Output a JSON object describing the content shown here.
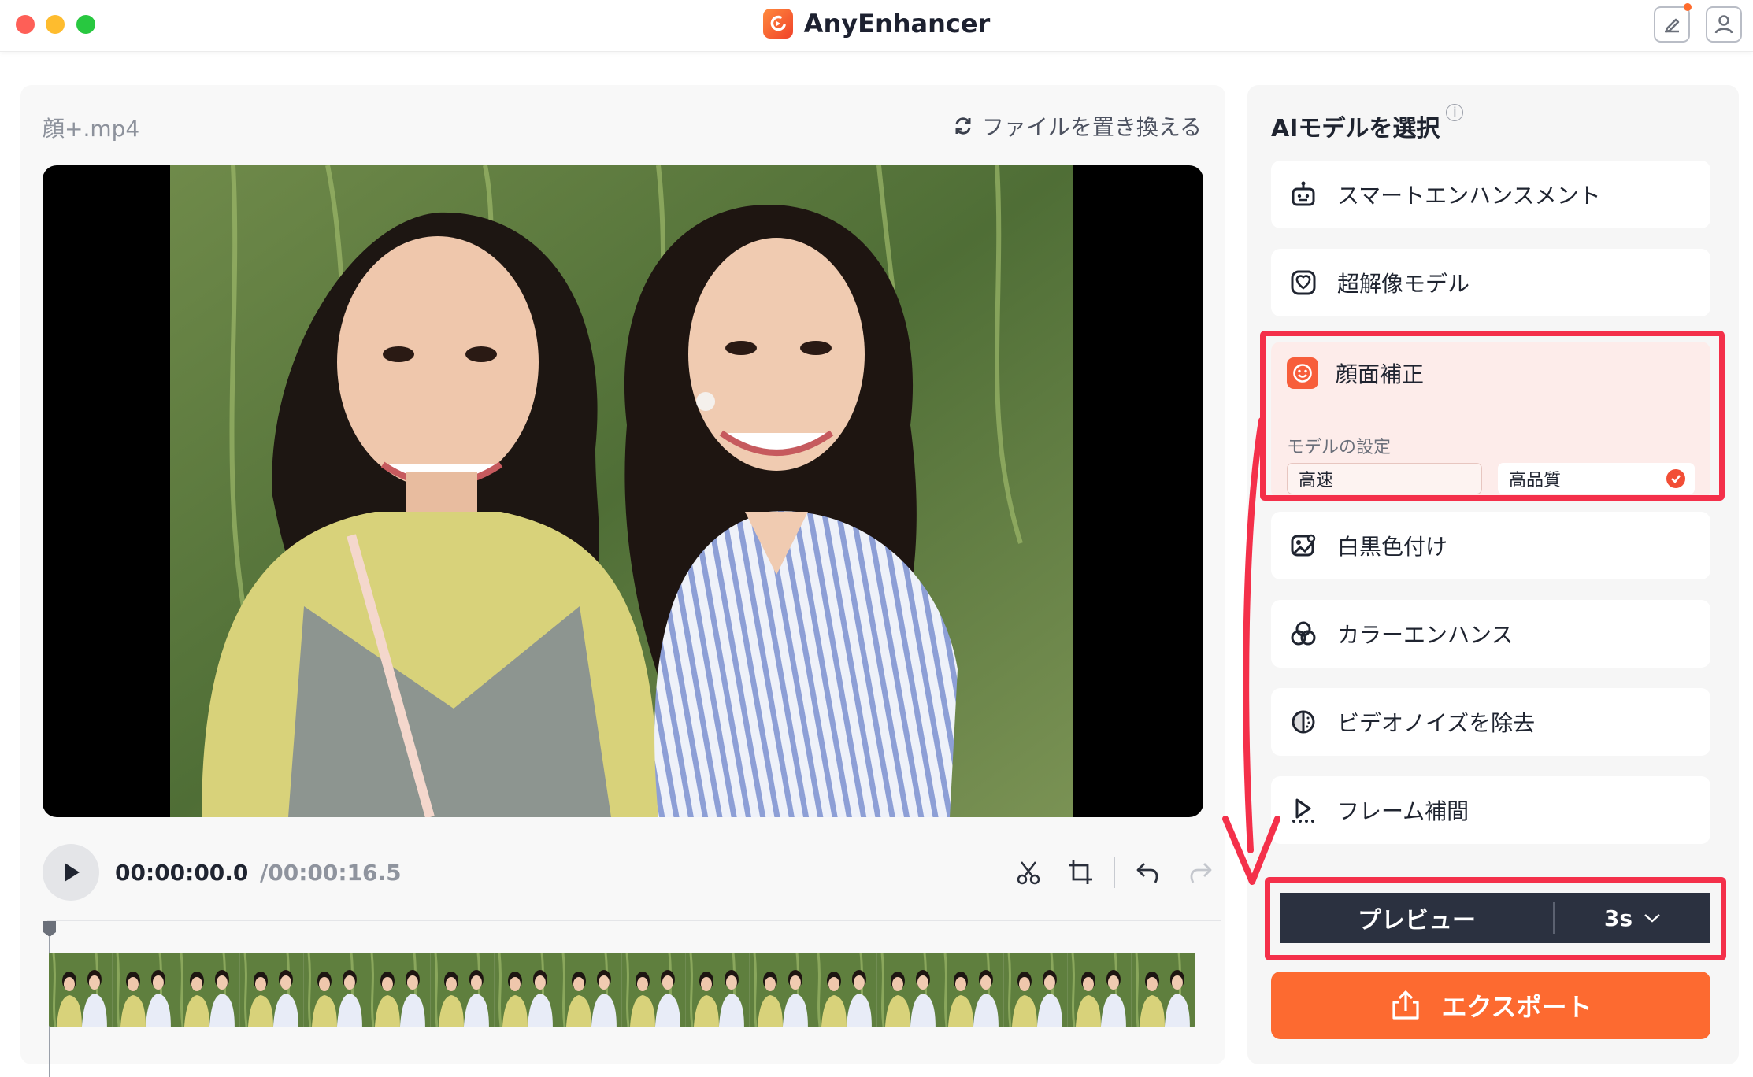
{
  "app": {
    "title": "AnyEnhancer"
  },
  "file": {
    "name": "顔+.mp4",
    "replace_label": "ファイルを置き換える"
  },
  "player": {
    "current_time": "00:00:00.0",
    "total_time": "/00:00:16.5"
  },
  "panel": {
    "title": "AIモデルを選択"
  },
  "models": [
    {
      "label": "スマートエンハンスメント",
      "icon": "robot-icon"
    },
    {
      "label": "超解像モデル",
      "icon": "super-resolution-icon"
    },
    {
      "label": "顔面補正",
      "icon": "smiley-face-icon",
      "selected": true
    },
    {
      "label": "白黒色付け",
      "icon": "colorize-icon"
    },
    {
      "label": "カラーエンハンス",
      "icon": "color-circles-icon"
    },
    {
      "label": "ビデオノイズを除去",
      "icon": "denoise-icon"
    },
    {
      "label": "フレーム補間",
      "icon": "frame-interpolation-icon"
    }
  ],
  "face_settings": {
    "label": "モデルの設定",
    "options": [
      {
        "label": "高速",
        "selected": false
      },
      {
        "label": "高品質",
        "selected": true
      }
    ]
  },
  "preview": {
    "label": "プレビュー",
    "duration": "3s"
  },
  "export": {
    "label": "エクスポート"
  },
  "colors": {
    "accent": "#fd6a30",
    "highlight": "#f4304a",
    "preview_bg": "#2b3140"
  }
}
